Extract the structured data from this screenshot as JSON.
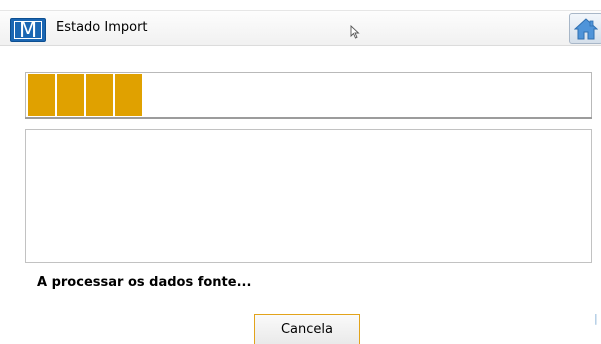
{
  "window": {
    "title": "Estado Import",
    "logo_letter": "M",
    "logo_icon": "app-logo-icon",
    "home_icon": "home-icon",
    "colors": {
      "logo": "#1a66b3",
      "home": "#4f94d9"
    }
  },
  "progress": {
    "filled_blocks": 4,
    "block_color": "#e0a100"
  },
  "log": {
    "text": ""
  },
  "status": {
    "message": "A processar os dados fonte..."
  },
  "actions": {
    "cancel_label": "Cancela",
    "cancel_border": "#e2a31b"
  }
}
